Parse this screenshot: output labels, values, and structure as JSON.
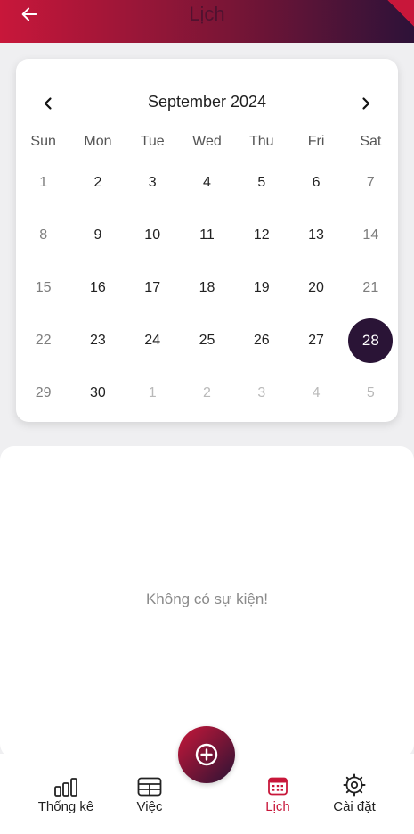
{
  "header": {
    "title": "Lịch"
  },
  "calendar": {
    "month_label": "September 2024",
    "weekdays": [
      "Sun",
      "Mon",
      "Tue",
      "Wed",
      "Thu",
      "Fri",
      "Sat"
    ],
    "weeks": [
      [
        "1",
        "2",
        "3",
        "4",
        "5",
        "6",
        "7"
      ],
      [
        "8",
        "9",
        "10",
        "11",
        "12",
        "13",
        "14"
      ],
      [
        "15",
        "16",
        "17",
        "18",
        "19",
        "20",
        "21"
      ],
      [
        "22",
        "23",
        "24",
        "25",
        "26",
        "27",
        "28"
      ],
      [
        "29",
        "30",
        "1",
        "2",
        "3",
        "4",
        "5"
      ]
    ],
    "selected_day": "28"
  },
  "events": {
    "empty_text": "Không có sự kiện!"
  },
  "bottom_nav": {
    "items": [
      {
        "label": "Thống kê",
        "icon": "bar-chart-icon"
      },
      {
        "label": "Việc",
        "icon": "table-icon"
      },
      {
        "label": "Lịch",
        "icon": "calendar-icon",
        "active": true
      },
      {
        "label": "Cài đặt",
        "icon": "settings-icon"
      }
    ],
    "fab_icon": "add-circle-icon"
  },
  "colors": {
    "accent": "#c8173a",
    "dark": "#2a1436",
    "background": "#efeff1"
  }
}
